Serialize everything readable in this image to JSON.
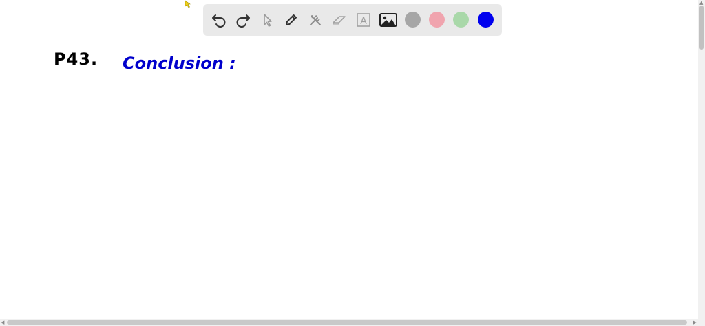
{
  "toolbar": {
    "tools": [
      {
        "name": "undo-icon"
      },
      {
        "name": "redo-icon"
      },
      {
        "name": "pointer-icon"
      },
      {
        "name": "pen-icon"
      },
      {
        "name": "tools-icon"
      },
      {
        "name": "eraser-icon"
      },
      {
        "name": "text-icon",
        "glyph": "A"
      },
      {
        "name": "image-icon"
      }
    ],
    "colors": [
      "#a6a6a6",
      "#f0a4ae",
      "#a9d8a9",
      "#0000ee"
    ]
  },
  "canvas": {
    "problem_label": "P43.",
    "heading": "Conclusion :",
    "problem_color": "#000000",
    "heading_color": "#0000cc"
  }
}
